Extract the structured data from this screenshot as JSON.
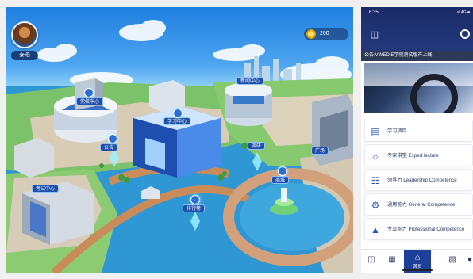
{
  "game": {
    "player_name": "泰晤",
    "coins": "200",
    "buildings": [
      {
        "id": "exhibition",
        "label": "党校中心"
      },
      {
        "id": "study",
        "label": "学习中心"
      },
      {
        "id": "announce",
        "label": "公告"
      },
      {
        "id": "exam",
        "label": "考试中心"
      },
      {
        "id": "ranking",
        "label": "排行榜"
      },
      {
        "id": "mall",
        "label": "商城"
      },
      {
        "id": "news",
        "label": "新闻中心"
      },
      {
        "id": "survey",
        "label": "调研"
      },
      {
        "id": "square",
        "label": "广场"
      }
    ]
  },
  "phone": {
    "status_time": "6:35",
    "status_right": "ııl 4G ■",
    "notice": "公告:VWED E学院测试版产上线",
    "menu": [
      {
        "icon": "book-icon",
        "label": "学习项目"
      },
      {
        "icon": "bulb-icon",
        "label": "专家讲堂 Expert lecture"
      },
      {
        "icon": "leader-icon",
        "label": "领导力 Leadership Competence"
      },
      {
        "icon": "gear-icon",
        "label": "通用能力 General Competence"
      },
      {
        "icon": "cap-icon",
        "label": "专业能力 Professional Competence"
      }
    ],
    "tab_home_label": "首页"
  },
  "colors": {
    "phone_header": "#1a2b66",
    "accent": "#1e3f9a",
    "sea": "#3aa0d8"
  }
}
